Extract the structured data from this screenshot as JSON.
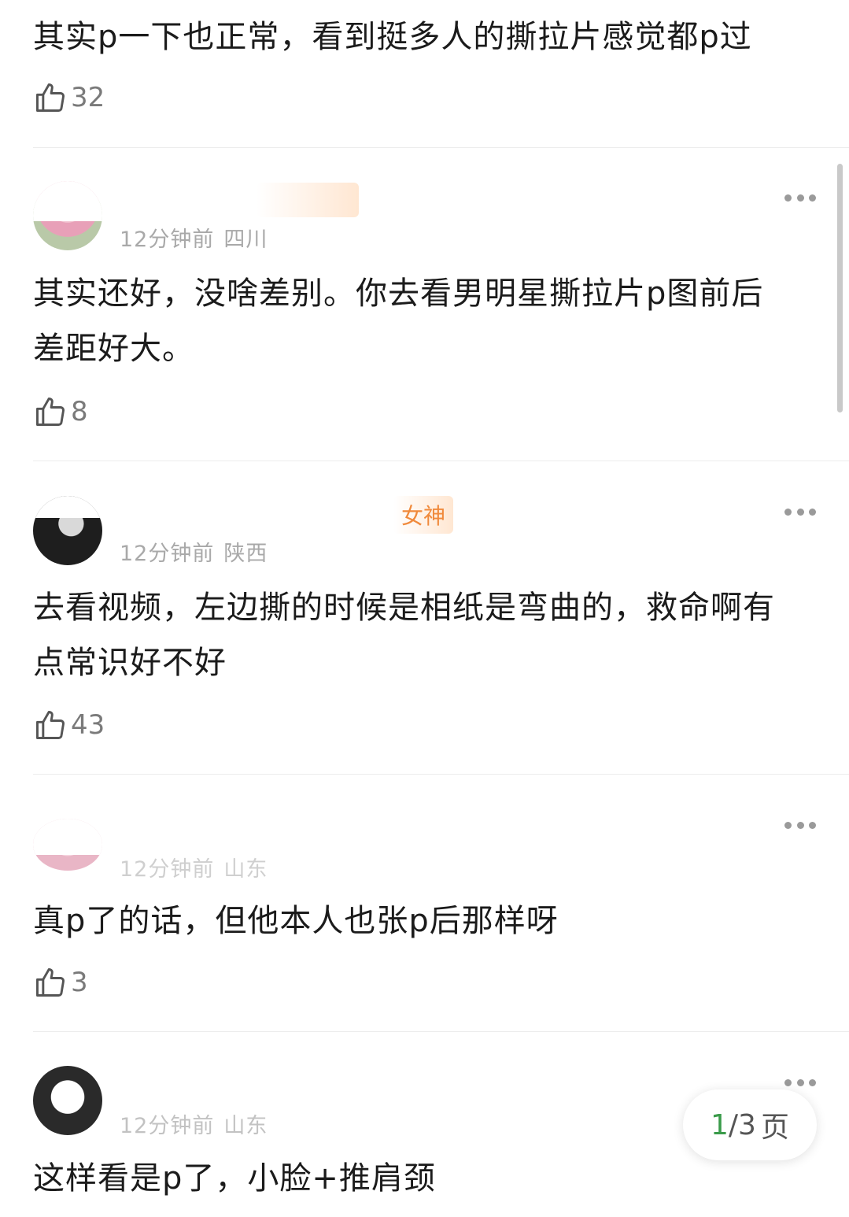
{
  "comments": [
    {
      "content": "其实p一下也正常，看到挺多人的撕拉片感觉都p过",
      "likes": "32"
    },
    {
      "user_tag": "",
      "time": "12分钟前",
      "region": "四川",
      "content": "其实还好，没啥差别。你去看男明星撕拉片p图前后差距好大。",
      "likes": "8"
    },
    {
      "user_tag": "女神",
      "time": "12分钟前",
      "region": "陕西",
      "content": "去看视频，左边撕的时候是相纸是弯曲的，救命啊有点常识好不好",
      "likes": "43"
    },
    {
      "time": "12分钟前",
      "region": "山东",
      "content": "真p了的话，但他本人也张p后那样呀",
      "likes": "3"
    },
    {
      "time": "12分钟前",
      "region": "山东",
      "content": "这样看是p了，小脸+推肩颈"
    }
  ],
  "pager": {
    "current": "1",
    "total": "/3",
    "unit": "页"
  },
  "icons": {
    "like": "thumbs-up-icon",
    "more": "more-dots-icon"
  }
}
